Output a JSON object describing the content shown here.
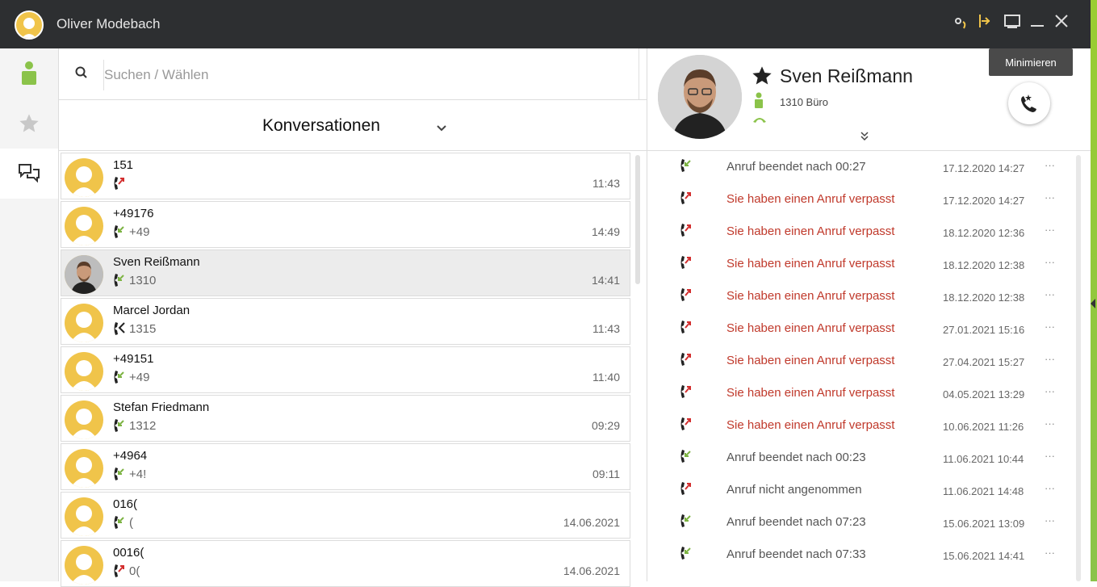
{
  "window": {
    "title": "Oliver Modebach",
    "tooltip": "Minimieren",
    "accent_color": "#8bc34a"
  },
  "sidebar": {
    "items": [
      {
        "icon": "person-icon",
        "label": "contacts"
      },
      {
        "icon": "star-icon",
        "label": "favorites"
      },
      {
        "icon": "chat-icon",
        "label": "conversations"
      }
    ]
  },
  "search": {
    "placeholder": "Suchen / Wählen",
    "value": ""
  },
  "conversations": {
    "title": "Konversationen",
    "items": [
      {
        "name": "151",
        "number": "",
        "time": "11:43",
        "call": "missed"
      },
      {
        "name": "+49176",
        "number": "+49",
        "time": "14:49",
        "call": "incoming"
      },
      {
        "name": "Sven Reißmann",
        "number": "1310",
        "time": "14:41",
        "call": "incoming"
      },
      {
        "name": "Marcel Jordan",
        "number": "1315",
        "time": "11:43",
        "call": "outgoing"
      },
      {
        "name": "+49151",
        "number": "+49",
        "time": "11:40",
        "call": "incoming"
      },
      {
        "name": "Stefan Friedmann",
        "number": "1312",
        "time": "09:29",
        "call": "incoming"
      },
      {
        "name": "+4964",
        "number": "+4!",
        "time": "09:11",
        "call": "incoming"
      },
      {
        "name": "016(",
        "number": "(",
        "time": "14.06.2021",
        "call": "incoming"
      },
      {
        "name": "0016(",
        "number": "0(",
        "time": "14.06.2021",
        "call": "missed"
      }
    ]
  },
  "contact": {
    "name": "Sven Reißmann",
    "extension": "1310 Büro"
  },
  "history": {
    "items": [
      {
        "text": "Anruf beendet nach 00:27",
        "date": "17.12.2020 14:27",
        "type": "normal",
        "call": "incoming"
      },
      {
        "text": "Sie haben einen Anruf verpasst",
        "date": "17.12.2020 14:27",
        "type": "missed",
        "call": "missed"
      },
      {
        "text": "Sie haben einen Anruf verpasst",
        "date": "18.12.2020 12:36",
        "type": "missed",
        "call": "missed"
      },
      {
        "text": "Sie haben einen Anruf verpasst",
        "date": "18.12.2020 12:38",
        "type": "missed",
        "call": "missed"
      },
      {
        "text": "Sie haben einen Anruf verpasst",
        "date": "18.12.2020 12:38",
        "type": "missed",
        "call": "missed"
      },
      {
        "text": "Sie haben einen Anruf verpasst",
        "date": "27.01.2021 15:16",
        "type": "missed",
        "call": "missed"
      },
      {
        "text": "Sie haben einen Anruf verpasst",
        "date": "27.04.2021 15:27",
        "type": "missed",
        "call": "missed"
      },
      {
        "text": "Sie haben einen Anruf verpasst",
        "date": "04.05.2021 13:29",
        "type": "missed",
        "call": "missed"
      },
      {
        "text": "Sie haben einen Anruf verpasst",
        "date": "10.06.2021 11:26",
        "type": "missed",
        "call": "missed"
      },
      {
        "text": "Anruf beendet nach 00:23",
        "date": "11.06.2021 10:44",
        "type": "normal",
        "call": "incoming"
      },
      {
        "text": "Anruf nicht angenommen",
        "date": "11.06.2021 14:48",
        "type": "normal",
        "call": "missed"
      },
      {
        "text": "Anruf beendet nach 07:23",
        "date": "15.06.2021 13:09",
        "type": "normal",
        "call": "incoming"
      },
      {
        "text": "Anruf beendet nach 07:33",
        "date": "15.06.2021 14:41",
        "type": "normal",
        "call": "incoming"
      }
    ]
  },
  "colors": {
    "missed": "#c0392b",
    "incoming_arrow": "#7cb342",
    "missed_arrow": "#d32f2f",
    "titlebar": "#2d2f31",
    "avatar": "#f0c44a"
  }
}
